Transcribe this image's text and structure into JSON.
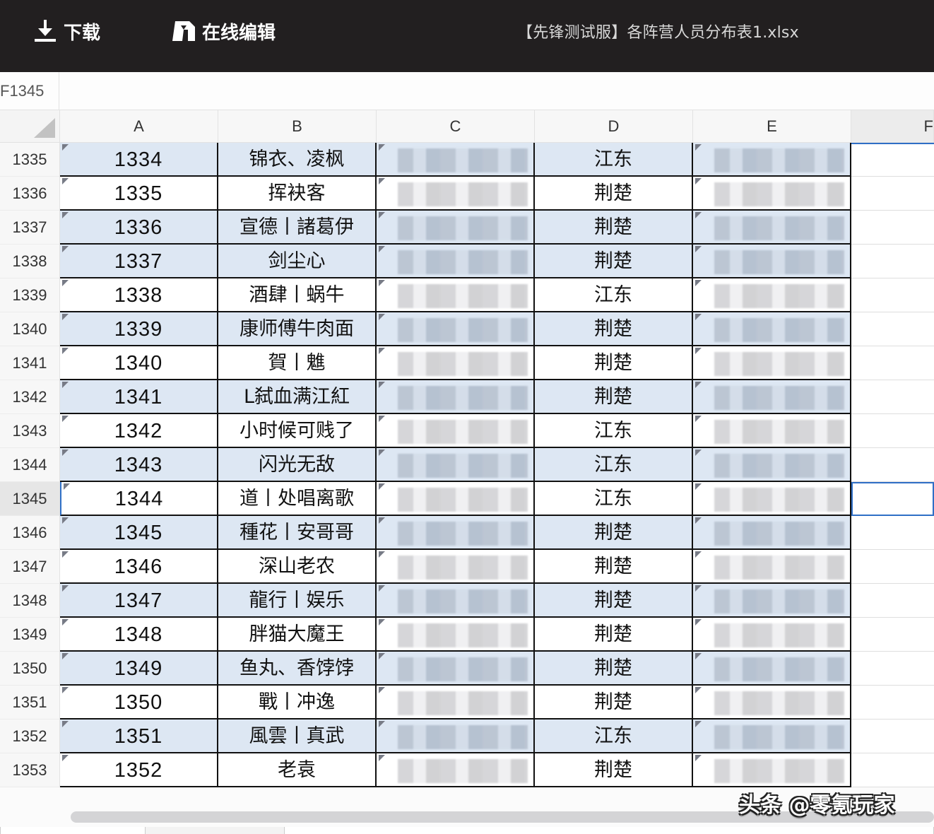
{
  "toolbar": {
    "download_label": "下载",
    "download_icon": "download-icon",
    "online_edit_label": "在线编辑",
    "online_edit_icon": "edit-document-icon",
    "file_title": "【先锋测试服】各阵营人员分布表1.xlsx"
  },
  "formula_bar": {
    "cell_reference": "F1345",
    "formula_value": ""
  },
  "columns": [
    "A",
    "B",
    "C",
    "D",
    "E",
    "F"
  ],
  "selected_cell": "F1345",
  "rows": [
    {
      "row": "1335",
      "a": "1334",
      "b": "锦衣、凌枫",
      "c": "",
      "d": "江东",
      "e": ""
    },
    {
      "row": "1336",
      "a": "1335",
      "b": "挥袂客",
      "c": "",
      "d": "荆楚",
      "e": ""
    },
    {
      "row": "1337",
      "a": "1336",
      "b": "宣德丨諸葛伊",
      "c": "",
      "d": "荆楚",
      "e": ""
    },
    {
      "row": "1338",
      "a": "1337",
      "b": "剑尘心",
      "c": "",
      "d": "荆楚",
      "e": ""
    },
    {
      "row": "1339",
      "a": "1338",
      "b": "酒肆丨蜗牛",
      "c": "",
      "d": "江东",
      "e": ""
    },
    {
      "row": "1340",
      "a": "1339",
      "b": "康师傅牛肉面",
      "c": "",
      "d": "荆楚",
      "e": ""
    },
    {
      "row": "1341",
      "a": "1340",
      "b": "賀丨魋",
      "c": "",
      "d": "荆楚",
      "e": ""
    },
    {
      "row": "1342",
      "a": "1341",
      "b": "L弑血满江紅",
      "c": "",
      "d": "荆楚",
      "e": ""
    },
    {
      "row": "1343",
      "a": "1342",
      "b": "小时候可贱了",
      "c": "",
      "d": "江东",
      "e": ""
    },
    {
      "row": "1344",
      "a": "1343",
      "b": "闪光无敌",
      "c": "",
      "d": "江东",
      "e": ""
    },
    {
      "row": "1345",
      "a": "1344",
      "b": "道丨处唱离歌",
      "c": "",
      "d": "江东",
      "e": ""
    },
    {
      "row": "1346",
      "a": "1345",
      "b": "種花丨安哥哥",
      "c": "",
      "d": "荆楚",
      "e": ""
    },
    {
      "row": "1347",
      "a": "1346",
      "b": "深山老农",
      "c": "",
      "d": "荆楚",
      "e": ""
    },
    {
      "row": "1348",
      "a": "1347",
      "b": "龍行丨娱乐",
      "c": "",
      "d": "荆楚",
      "e": ""
    },
    {
      "row": "1349",
      "a": "1348",
      "b": "胖猫大魔王",
      "c": "",
      "d": "荆楚",
      "e": ""
    },
    {
      "row": "1350",
      "a": "1349",
      "b": "鱼丸、香饽饽",
      "c": "",
      "d": "荆楚",
      "e": ""
    },
    {
      "row": "1351",
      "a": "1350",
      "b": "戰丨冲逸",
      "c": "",
      "d": "荆楚",
      "e": ""
    },
    {
      "row": "1352",
      "a": "1351",
      "b": "風雲丨真武",
      "c": "",
      "d": "江东",
      "e": ""
    },
    {
      "row": "1353",
      "a": "1352",
      "b": "老袁",
      "c": "",
      "d": "荆楚",
      "e": ""
    }
  ],
  "watermark": "头条 @零氪玩家",
  "colors": {
    "toolbar_bg": "#221f20",
    "shaded_row": "#dde7f3",
    "selection_border": "#2f6fc6"
  }
}
